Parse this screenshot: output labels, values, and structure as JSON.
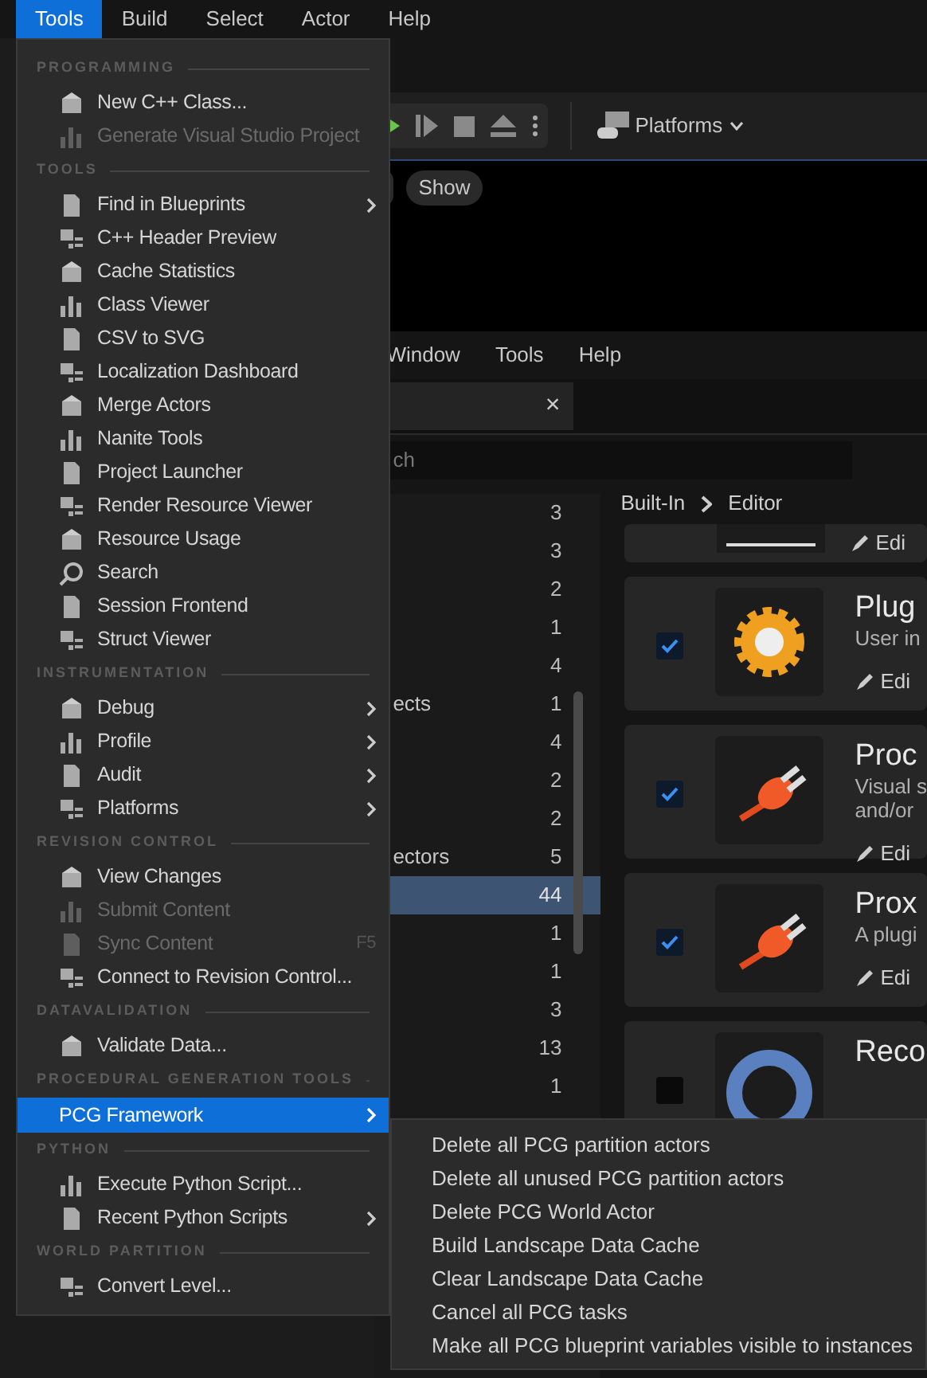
{
  "menubar": [
    {
      "label": "Tools",
      "selected": true
    },
    {
      "label": "Build",
      "selected": false
    },
    {
      "label": "Select",
      "selected": false
    },
    {
      "label": "Actor",
      "selected": false
    },
    {
      "label": "Help",
      "selected": false
    }
  ],
  "tools_menu": [
    {
      "header": "PROGRAMMING",
      "items": [
        {
          "label": "New C++ Class...",
          "disabled": false,
          "submenu": false,
          "selected": false
        },
        {
          "label": "Generate Visual Studio Project",
          "disabled": true,
          "submenu": false,
          "selected": false
        }
      ]
    },
    {
      "header": "TOOLS",
      "items": [
        {
          "label": "Find in Blueprints",
          "disabled": false,
          "submenu": true,
          "selected": false
        },
        {
          "label": "C++ Header Preview",
          "disabled": false,
          "submenu": false,
          "selected": false
        },
        {
          "label": "Cache Statistics",
          "disabled": false,
          "submenu": false,
          "selected": false
        },
        {
          "label": "Class Viewer",
          "disabled": false,
          "submenu": false,
          "selected": false
        },
        {
          "label": "CSV to SVG",
          "disabled": false,
          "submenu": false,
          "selected": false
        },
        {
          "label": "Localization Dashboard",
          "disabled": false,
          "submenu": false,
          "selected": false
        },
        {
          "label": "Merge Actors",
          "disabled": false,
          "submenu": false,
          "selected": false
        },
        {
          "label": "Nanite Tools",
          "disabled": false,
          "submenu": false,
          "selected": false
        },
        {
          "label": "Project Launcher",
          "disabled": false,
          "submenu": false,
          "selected": false
        },
        {
          "label": "Render Resource Viewer",
          "disabled": false,
          "submenu": false,
          "selected": false
        },
        {
          "label": "Resource Usage",
          "disabled": false,
          "submenu": false,
          "selected": false
        },
        {
          "label": "Search",
          "disabled": false,
          "submenu": false,
          "selected": false
        },
        {
          "label": "Session Frontend",
          "disabled": false,
          "submenu": false,
          "selected": false
        },
        {
          "label": "Struct Viewer",
          "disabled": false,
          "submenu": false,
          "selected": false
        }
      ]
    },
    {
      "header": "INSTRUMENTATION",
      "items": [
        {
          "label": "Debug",
          "disabled": false,
          "submenu": true,
          "selected": false
        },
        {
          "label": "Profile",
          "disabled": false,
          "submenu": true,
          "selected": false
        },
        {
          "label": "Audit",
          "disabled": false,
          "submenu": true,
          "selected": false
        },
        {
          "label": "Platforms",
          "disabled": false,
          "submenu": true,
          "selected": false
        }
      ]
    },
    {
      "header": "REVISION CONTROL",
      "items": [
        {
          "label": "View Changes",
          "disabled": false,
          "submenu": false,
          "selected": false
        },
        {
          "label": "Submit Content",
          "disabled": true,
          "submenu": false,
          "selected": false
        },
        {
          "label": "Sync Content",
          "disabled": true,
          "submenu": false,
          "selected": false,
          "shortcut": "F5"
        },
        {
          "label": "Connect to Revision Control...",
          "disabled": false,
          "submenu": false,
          "selected": false
        }
      ]
    },
    {
      "header": "DATAVALIDATION",
      "items": [
        {
          "label": "Validate Data...",
          "disabled": false,
          "submenu": false,
          "selected": false
        }
      ]
    },
    {
      "header": "PROCEDURAL GENERATION TOOLS",
      "items": [
        {
          "label": "PCG Framework",
          "disabled": false,
          "submenu": true,
          "selected": true
        }
      ]
    },
    {
      "header": "PYTHON",
      "items": [
        {
          "label": "Execute Python Script...",
          "disabled": false,
          "submenu": false,
          "selected": false
        },
        {
          "label": "Recent Python Scripts",
          "disabled": false,
          "submenu": true,
          "selected": false
        }
      ]
    },
    {
      "header": "WORLD PARTITION",
      "items": [
        {
          "label": "Convert Level...",
          "disabled": false,
          "submenu": false,
          "selected": false
        }
      ]
    }
  ],
  "pcg_submenu": [
    "Delete all PCG partition actors",
    "Delete all unused PCG partition actors",
    "Delete PCG World Actor",
    "Build Landscape Data Cache",
    "Clear Landscape Data Cache",
    "Cancel all PCG tasks",
    "Make all PCG blueprint variables visible to instances"
  ],
  "toolbar": {
    "platforms": "Platforms"
  },
  "viewport": {
    "show_button": "Show"
  },
  "plugins_window": {
    "menu": [
      "Window",
      "Tools",
      "Help"
    ],
    "tab_close": "×",
    "search": {
      "placeholder": "ch"
    },
    "categories": [
      {
        "count": "3",
        "selected": false
      },
      {
        "count": "3",
        "selected": false
      },
      {
        "count": "2",
        "selected": false
      },
      {
        "count": "1",
        "selected": false
      },
      {
        "count": "4",
        "selected": false
      },
      {
        "label": "ects",
        "count": "1",
        "selected": false
      },
      {
        "count": "4",
        "selected": false
      },
      {
        "count": "2",
        "selected": false
      },
      {
        "count": "2",
        "selected": false
      },
      {
        "label": "ectors",
        "count": "5",
        "selected": false
      },
      {
        "count": "44",
        "selected": true
      },
      {
        "count": "1",
        "selected": false
      },
      {
        "count": "1",
        "selected": false
      },
      {
        "count": "3",
        "selected": false
      },
      {
        "count": "13",
        "selected": false
      },
      {
        "count": "1",
        "selected": false
      }
    ],
    "breadcrumb": [
      "Built-In",
      "Editor"
    ],
    "plugins": [
      {
        "kind": "partial",
        "edit": "Edi"
      },
      {
        "kind": "gear",
        "checked": true,
        "title": "Plug",
        "description": [
          "User in"
        ],
        "edit": "Edi"
      },
      {
        "kind": "plug",
        "checked": true,
        "title": "Proc",
        "description": [
          "Visual s",
          "and/or"
        ],
        "edit": "Edi"
      },
      {
        "kind": "plug",
        "checked": true,
        "title": "Prox",
        "description": [
          "A plugi"
        ],
        "edit": "Edi"
      },
      {
        "kind": "ring",
        "checked": false,
        "title": "Reco"
      }
    ]
  }
}
